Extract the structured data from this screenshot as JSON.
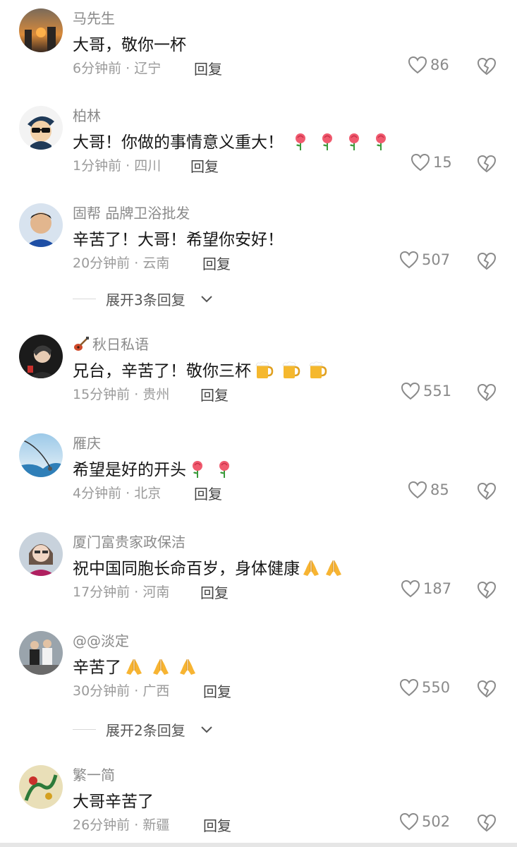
{
  "comments": [
    {
      "username": "马先生",
      "text": "大哥，敬你一杯",
      "time": "6分钟前",
      "location": "辽宁",
      "reply": "回复",
      "likes": "86"
    },
    {
      "username": "柏林",
      "text": "大哥！你做的事情意义重大！",
      "time": "1分钟前",
      "location": "四川",
      "reply": "回复",
      "likes": "15",
      "emojis": [
        "rose",
        "rose",
        "rose",
        "rose"
      ]
    },
    {
      "username": "固帮 品牌卫浴批发",
      "text": "辛苦了！大哥！希望你安好！",
      "time": "20分钟前",
      "location": "云南",
      "reply": "回复",
      "likes": "507"
    },
    {
      "username": "秋日私语",
      "text": "兄台，辛苦了！敬你三杯",
      "time": "15分钟前",
      "location": "贵州",
      "reply": "回复",
      "likes": "551",
      "emojis": [
        "beer",
        "beer",
        "beer"
      ],
      "name_icon": "guitar-icon"
    },
    {
      "username": "雁庆",
      "text": "希望是好的开头",
      "time": "4分钟前",
      "location": "北京",
      "reply": "回复",
      "likes": "85",
      "emojis": [
        "rose",
        "rose"
      ]
    },
    {
      "username": "厦门富贵家政保洁",
      "text": "祝中国同胞长命百岁，身体健康",
      "time": "17分钟前",
      "location": "河南",
      "reply": "回复",
      "likes": "187",
      "emojis": [
        "pray",
        "pray"
      ]
    },
    {
      "username": "@@淡定",
      "text": "辛苦了",
      "time": "30分钟前",
      "location": "广西",
      "reply": "回复",
      "likes": "550",
      "emojis": [
        "pray",
        "pray",
        "pray"
      ]
    },
    {
      "username": "繁一简",
      "text": "大哥辛苦了",
      "time": "26分钟前",
      "location": "新疆",
      "reply": "回复",
      "likes": "502"
    }
  ],
  "expand": [
    {
      "label": "展开3条回复"
    },
    {
      "label": "展开2条回复"
    }
  ],
  "icons": {
    "like": "heart-outline-icon",
    "dislike": "broken-heart-icon",
    "expand": "chevron-down-icon"
  }
}
